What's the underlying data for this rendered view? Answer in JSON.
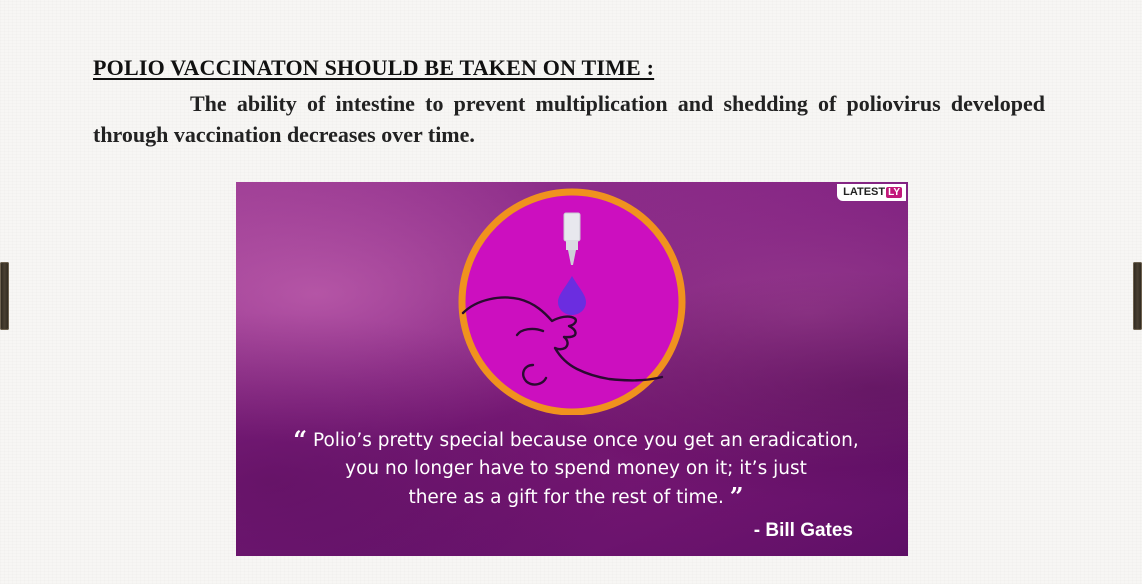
{
  "document": {
    "heading": "POLIO VACCINATON SHOULD BE TAKEN ON TIME :",
    "paragraph": "The ability of intestine to prevent multiplication and shedding of poliovirus developed through vaccination decreases over time."
  },
  "poster": {
    "brand_text": "LATEST",
    "brand_badge": "LY",
    "quote_open": "“",
    "quote_line1": "Polio’s pretty special because once you get an eradication,",
    "quote_line2": "you no longer have to spend money on it; it’s just",
    "quote_line3": "there as a gift for the rest of time.",
    "quote_close": "”",
    "author": "- Bill Gates",
    "icon": "polio-drops-infant-icon",
    "colors": {
      "background": "#7f1f80",
      "circle_fill": "#cc0fbf",
      "circle_ring": "#f0921e",
      "drop": "#6b2de0",
      "line_art": "#2a0a30",
      "brand_accent": "#c2187a"
    }
  }
}
